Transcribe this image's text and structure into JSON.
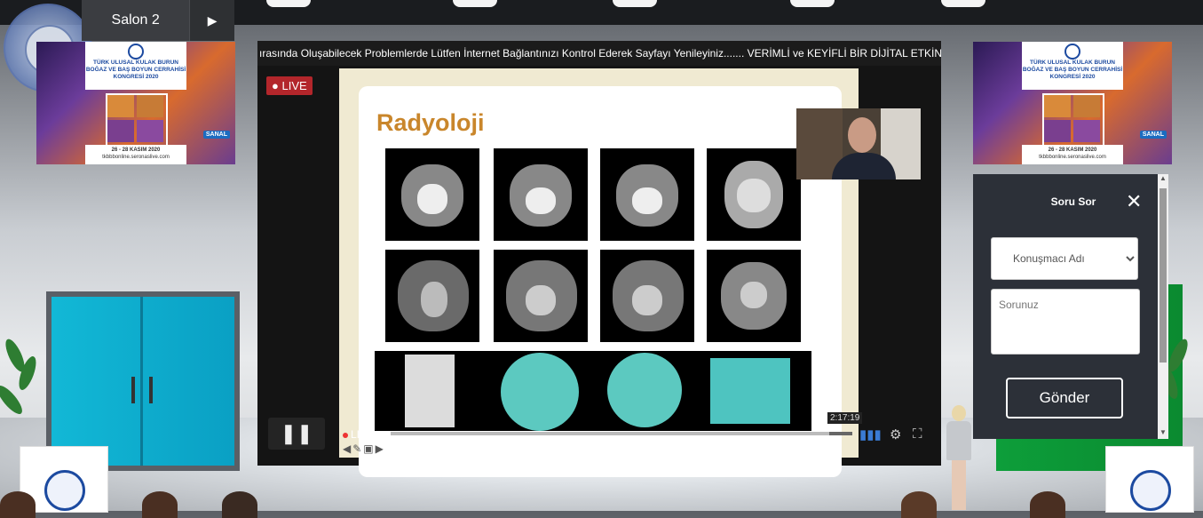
{
  "session": {
    "title": "Salon 2",
    "play_icon": "play-icon"
  },
  "posters": {
    "line1": "TÜRK ULUSAL KULAK BURUN",
    "line2": "BOĞAZ VE BAŞ BOYUN CERRAHİSİ",
    "line3": "KONGRESİ 2020",
    "dates": "26 - 28 KASIM 2020",
    "site": "tkbbbonline.seronaslive.com",
    "badge": "SANAL"
  },
  "logo": {
    "text": "TÜRK ULUSAL KULAK BURUN BOĞAZ BAŞ BOYUN CERRAHİSİ DERNEĞİ 1949"
  },
  "player": {
    "ticker": "ırasında Oluşabilecek Problemlerde Lütfen İnternet Bağlantınızı Kontrol Ederek Sayfayı Yenileyiniz....... VERİMLİ ve KEYİFLİ BİR DİJİTAL ETKİNLİK DENEYİ",
    "live_badge": "LIVE",
    "slide_title": "Radyoloji",
    "live_label": "LIVE",
    "timecode": "2:17:19",
    "pause_icon": "pause-icon",
    "settings_icon": "gear-icon",
    "fullscreen_icon": "fullscreen-icon",
    "signal_icon": "signal-bars-icon"
  },
  "question_panel": {
    "title": "Soru Sor",
    "close_icon": "close-icon",
    "speaker_select": "Konuşmacı Adı",
    "question_placeholder": "Sorunuz",
    "send_label": "Gönder"
  },
  "colors": {
    "live_red": "#b3262b",
    "slide_title": "#c9862b",
    "panel_bg": "#2c3038",
    "door": "#12b8d6",
    "wall_green": "#0d9e3a"
  }
}
